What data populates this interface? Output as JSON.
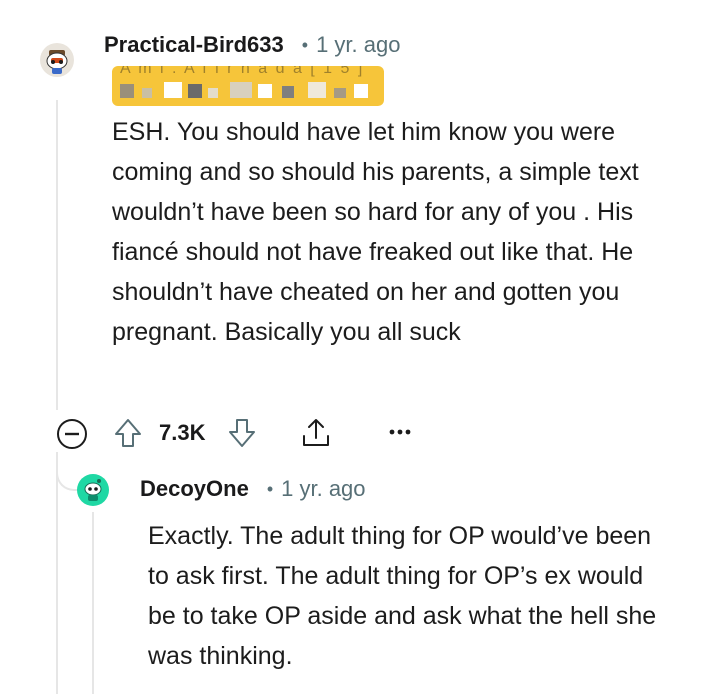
{
  "comment1": {
    "username": "Practical-Bird633",
    "separator": "•",
    "age": "1 yr. ago",
    "flair": "A m l . A f i r n a d a [ 1 5 ]",
    "body": "ESH. You should have let him know you were coming and so should his parents, a simple text wouldn’t have been so hard for any of you . His fiancé should not have freaked out like that. He shouldn’t have cheated on her and gotten you pregnant. Basically you all suck",
    "score": "7.3K",
    "avatar_icon": "snoo-avatar-icon",
    "colors": {
      "flair": "#f6c53a",
      "avatar": "#e9e4dc"
    }
  },
  "comment2": {
    "username": "DecoyOne",
    "separator": "•",
    "age": "1 yr. ago",
    "body": "Exactly. The adult thing for OP would’ve been to ask first. The adult thing for OP’s ex would be to take OP aside and ask what the hell she was thinking.",
    "avatar_icon": "snoo-avatar-icon",
    "colors": {
      "avatar": "#1fd8a4"
    }
  },
  "actions": {
    "collapse_icon": "collapse-minus-icon",
    "upvote_icon": "upvote-arrow-icon",
    "downvote_icon": "downvote-arrow-icon",
    "share_icon": "share-icon",
    "more_icon": "more-dots-icon"
  }
}
